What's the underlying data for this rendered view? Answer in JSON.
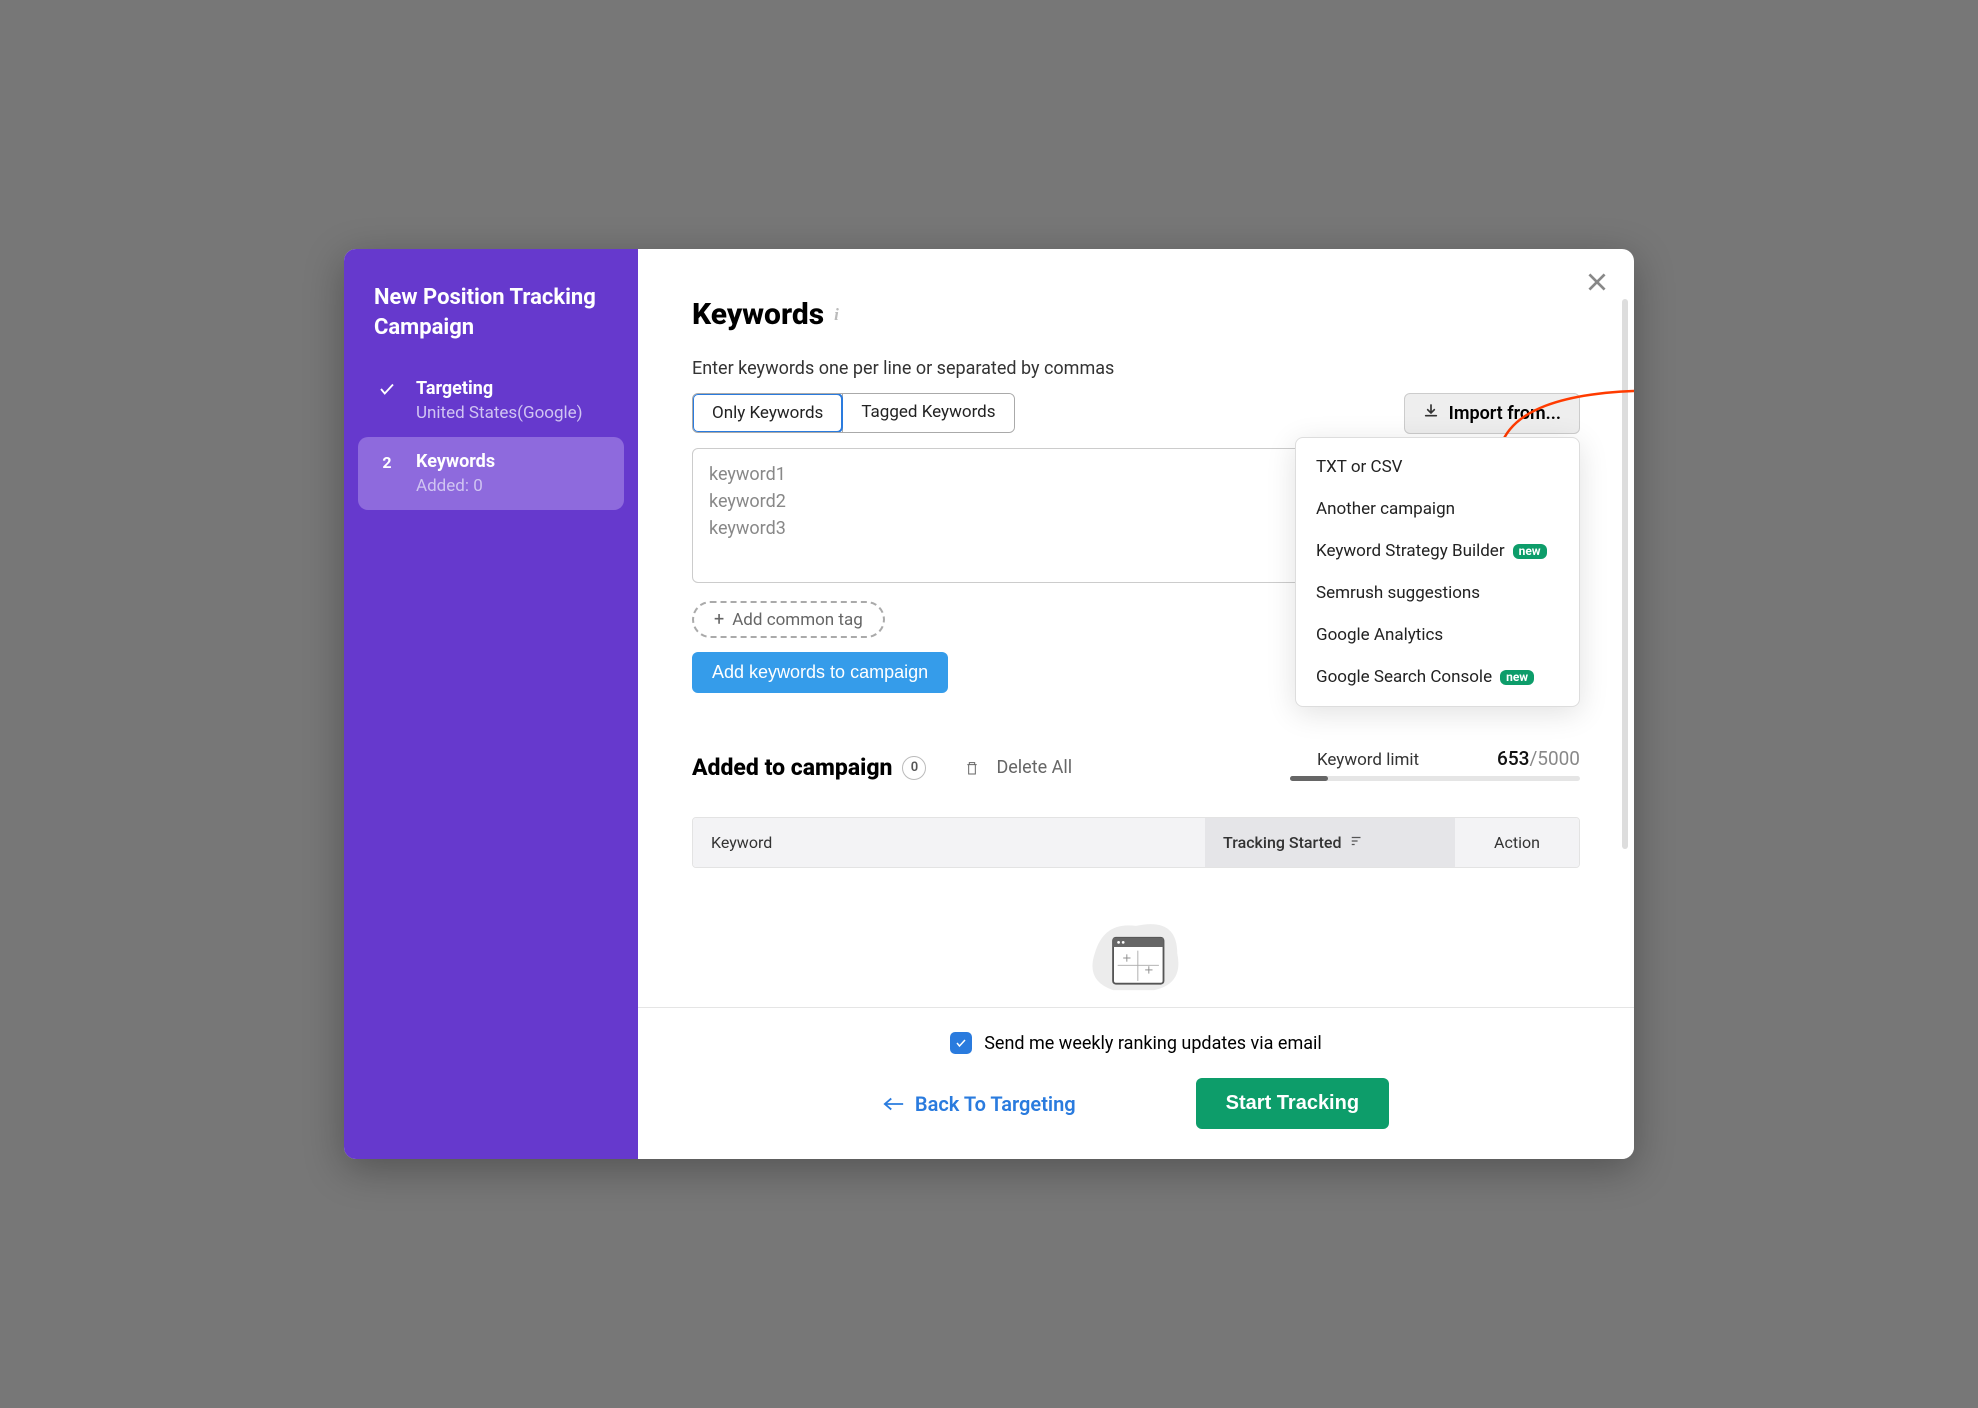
{
  "sidebar": {
    "title": "New Position Tracking Campaign",
    "steps": [
      {
        "num": "",
        "name": "Targeting",
        "sub": "United States(Google)",
        "done": true
      },
      {
        "num": "2",
        "name": "Keywords",
        "sub": "Added: 0",
        "active": true
      }
    ]
  },
  "page": {
    "title": "Keywords",
    "subtext": "Enter keywords one per line or separated by commas",
    "tabs": {
      "only": "Only Keywords",
      "tagged": "Tagged Keywords"
    },
    "import_label": "Import from...",
    "textarea_placeholder": "keyword1\nkeyword2\nkeyword3",
    "add_tag": "Add common tag",
    "add_kw": "Add keywords to campaign"
  },
  "import_menu": [
    {
      "label": "TXT or CSV",
      "badge": ""
    },
    {
      "label": "Another campaign",
      "badge": ""
    },
    {
      "label": "Keyword Strategy Builder",
      "badge": "new"
    },
    {
      "label": "Semrush suggestions",
      "badge": ""
    },
    {
      "label": "Google Analytics",
      "badge": ""
    },
    {
      "label": "Google Search Console",
      "badge": "new"
    }
  ],
  "added": {
    "title": "Added to campaign",
    "count": "0",
    "delete_all": "Delete All"
  },
  "limit": {
    "label": "Keyword limit",
    "used": "653",
    "total": "/5000"
  },
  "table": {
    "col_keyword": "Keyword",
    "col_tracking": "Tracking Started",
    "col_action": "Action"
  },
  "footer": {
    "weekly": "Send me weekly ranking updates via email",
    "back": "Back To Targeting",
    "start": "Start Tracking"
  }
}
